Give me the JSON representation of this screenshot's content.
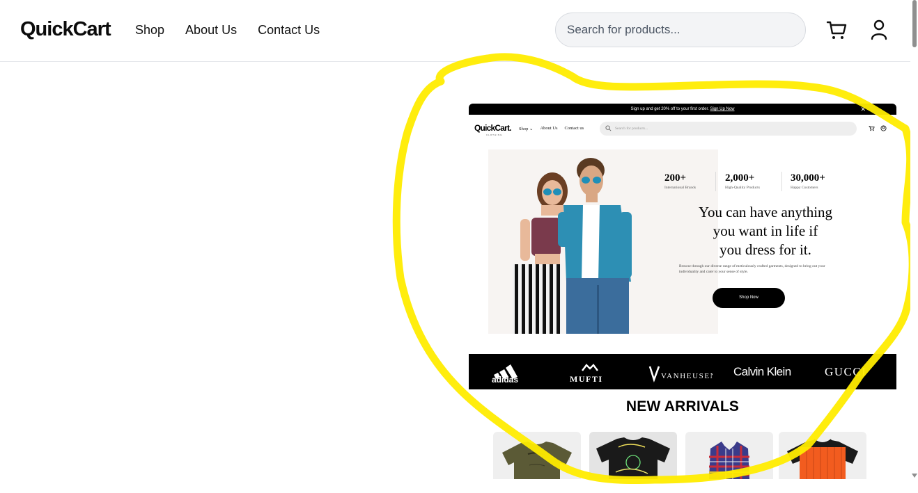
{
  "header": {
    "logo": "QuickCart",
    "nav": [
      {
        "label": "Shop"
      },
      {
        "label": "About Us"
      },
      {
        "label": "Contact Us"
      }
    ],
    "search_placeholder": "Search for products...",
    "icons": [
      "cart-icon",
      "user-icon"
    ]
  },
  "embedded": {
    "promo": {
      "text": "Sign up and get 20% off to your first order. ",
      "link": "Sign Up Now",
      "close": "✕"
    },
    "logo": "QuickCart.",
    "logo_sub": "CLOTHING",
    "nav": [
      "Shop ⌄",
      "About Us",
      "Contact us"
    ],
    "search_placeholder": "Search for products...",
    "stats": [
      {
        "value": "200+",
        "label": "International Brands"
      },
      {
        "value": "2,000+",
        "label": "High-Quality Products"
      },
      {
        "value": "30,000+",
        "label": "Happy Customers"
      }
    ],
    "headline_lines": [
      "You can have anything",
      "you want in life if",
      "you dress for it."
    ],
    "description": "Browse through our diverse range of meticulously crafted garments, designed to bring out your individuality and cater to your sense of style.",
    "cta": "Shop Now",
    "brands": [
      "adidas",
      "MUFTI",
      "VANHEUSEN",
      "Calvin Klein",
      "GUCCI"
    ],
    "section_title": "NEW ARRIVALS"
  },
  "colors": {
    "annotation": "#ffec00",
    "dark": "#000000",
    "olive_tee": "#5b5a36",
    "orange_tee": "#f25c1f"
  }
}
